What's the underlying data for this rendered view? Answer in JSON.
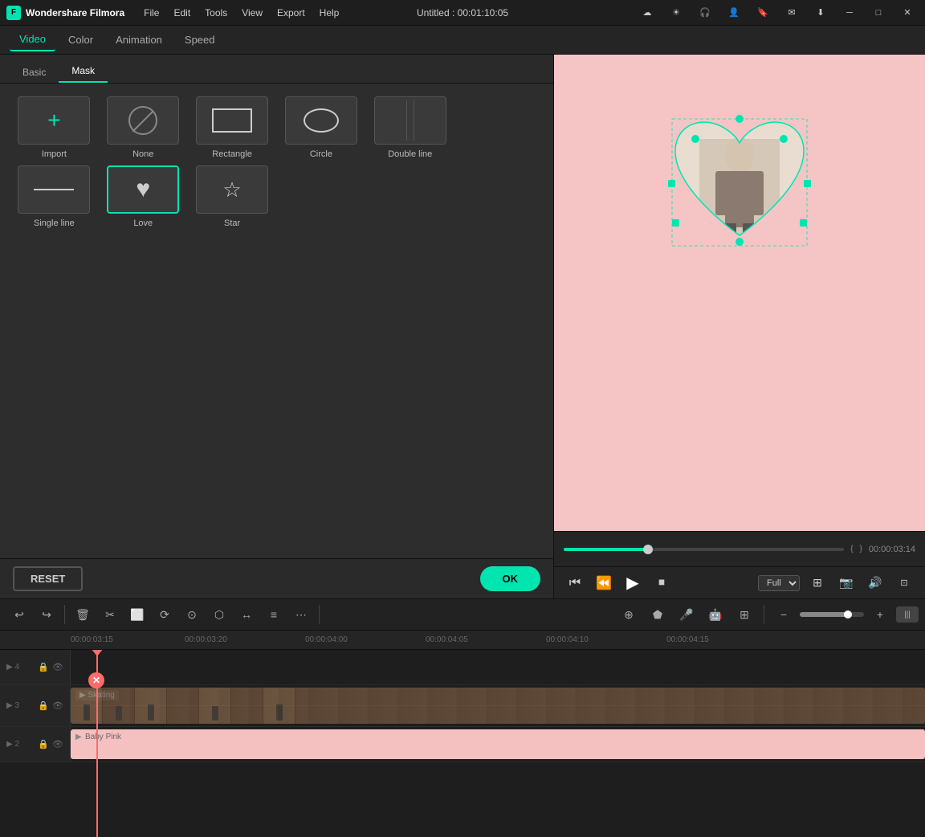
{
  "app": {
    "name": "Wondershare Filmora",
    "logo_letter": "F",
    "title": "Untitled : 00:01:10:05"
  },
  "menubar": {
    "items": [
      "File",
      "Edit",
      "Tools",
      "View",
      "Export",
      "Help"
    ]
  },
  "subtabs": {
    "items": [
      "Video",
      "Color",
      "Animation",
      "Speed"
    ],
    "active": "Video"
  },
  "mask_tabs": {
    "items": [
      "Basic",
      "Mask"
    ],
    "active": "Mask"
  },
  "mask_shapes": {
    "row1": [
      {
        "id": "import",
        "label": "Import",
        "type": "plus"
      },
      {
        "id": "none",
        "label": "None",
        "type": "none"
      },
      {
        "id": "rectangle",
        "label": "Rectangle",
        "type": "rect"
      },
      {
        "id": "circle",
        "label": "Circle",
        "type": "circle"
      },
      {
        "id": "double-line",
        "label": "Double line",
        "type": "dblline"
      },
      {
        "id": "spacer",
        "label": "",
        "type": "spacer"
      }
    ],
    "row2": [
      {
        "id": "single-line",
        "label": "Single line",
        "type": "singleline"
      },
      {
        "id": "love",
        "label": "Love",
        "type": "heart",
        "selected": true
      },
      {
        "id": "star",
        "label": "Star",
        "type": "star"
      },
      {
        "id": "empty1",
        "label": "",
        "type": "empty"
      },
      {
        "id": "empty2",
        "label": "",
        "type": "empty"
      },
      {
        "id": "empty3",
        "label": "",
        "type": "empty"
      }
    ]
  },
  "footer": {
    "reset_label": "RESET",
    "ok_label": "OK"
  },
  "player": {
    "time": "00:00:03:14",
    "duration": "00:01:10:05",
    "quality": "Full"
  },
  "toolbar": {
    "tools": [
      "↩",
      "↪",
      "🗑",
      "✂",
      "⬜",
      "⟳",
      "⊙",
      "⬡",
      "↔",
      "≡",
      "⋯"
    ]
  },
  "timeline": {
    "ruler_marks": [
      "00:00:03:15",
      "00:00:03:20",
      "00:00:04:00",
      "00:00:04:05",
      "00:00:04:10",
      "00:00:04:15"
    ],
    "tracks": [
      {
        "num": "4",
        "label": ""
      },
      {
        "num": "3",
        "label": "Skating"
      },
      {
        "num": "2",
        "label": "Baby Pink"
      }
    ]
  }
}
